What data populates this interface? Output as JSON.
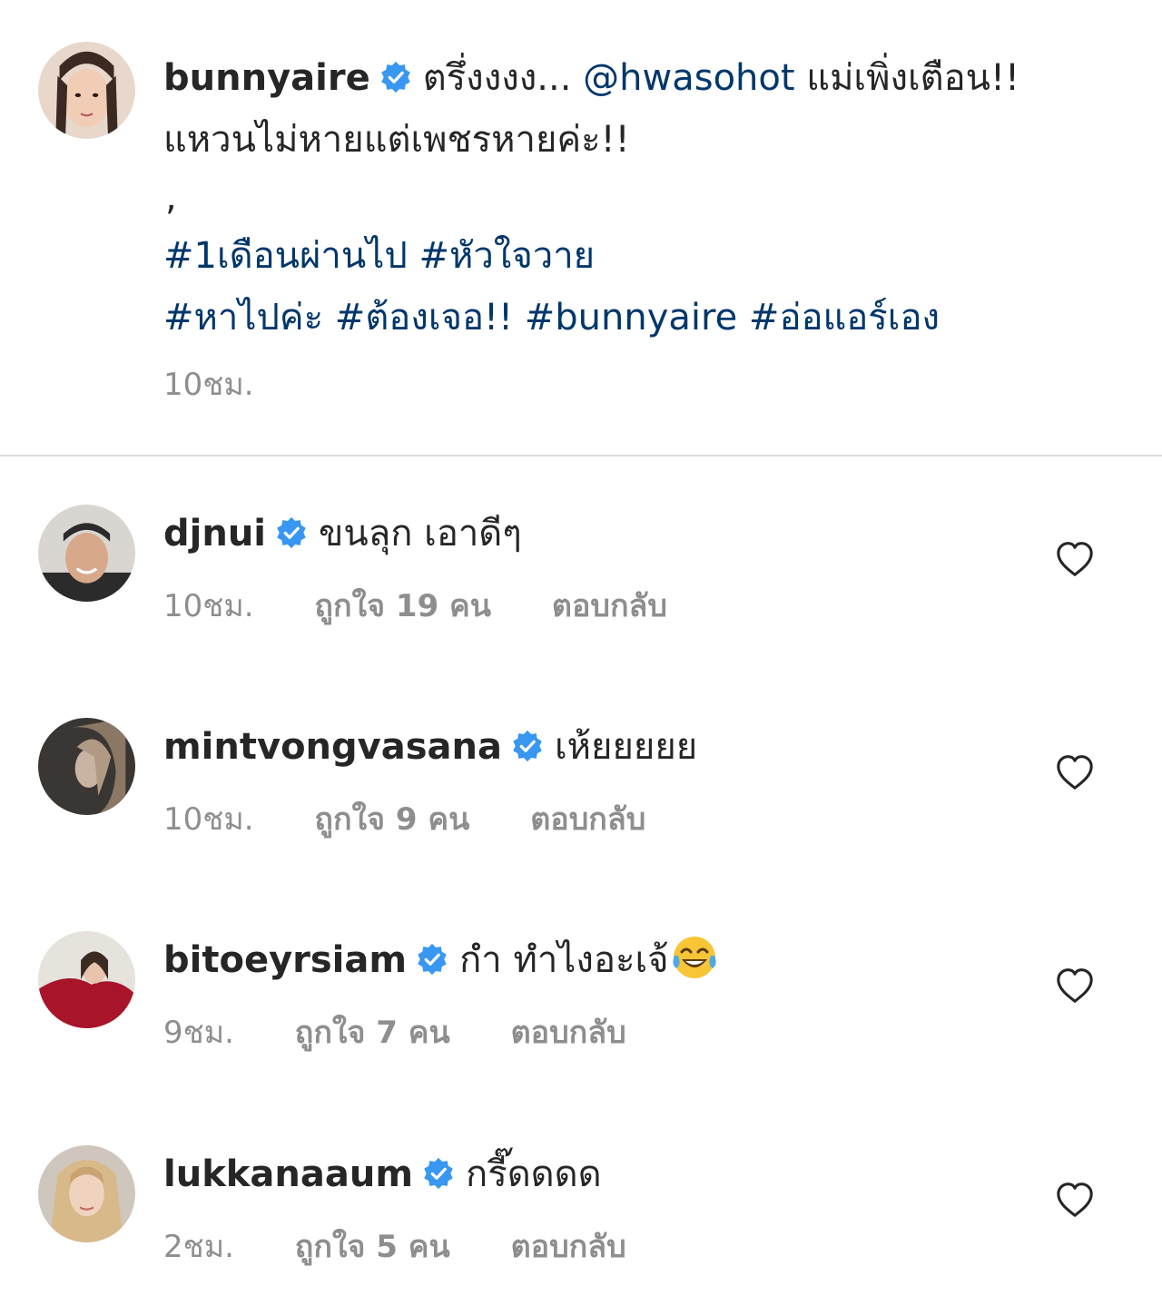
{
  "post": {
    "username": "bunnyaire",
    "text_line1": "ตรึ่งงงง...",
    "mention": "@hwasohot",
    "text_line1_end": "แม่เพิ่งเตือน!!",
    "text_line2": "แหวนไม่หายแต่เพชรหายค่ะ!!",
    "comma": ",",
    "hashtags_line1": "#1เดือนผ่านไป #หัวใจวาย",
    "hashtags_line2": "#หาไปค่ะ #ต้องเจอ!! #bunnyaire #อ่อแอร์เอง",
    "time": "10ชม."
  },
  "comments": [
    {
      "username": "djnui",
      "text": "ขนลุก เอาดีๆ",
      "time": "10ชม.",
      "likes": "ถูกใจ 19 คน",
      "reply": "ตอบกลับ"
    },
    {
      "username": "mintvongvasana",
      "text": "เห้ยยยยย",
      "time": "10ชม.",
      "likes": "ถูกใจ 9 คน",
      "reply": "ตอบกลับ"
    },
    {
      "username": "bitoeyrsiam",
      "text": "กำ ทำไงอะเจ้",
      "emoji": "tears-of-joy-emoji",
      "time": "9ชม.",
      "likes": "ถูกใจ 7 คน",
      "reply": "ตอบกลับ"
    },
    {
      "username": "lukkanaaum",
      "text": "กรี๊ดดดด",
      "time": "2ชม.",
      "likes": "ถูกใจ 5 คน",
      "reply": "ตอบกลับ"
    }
  ],
  "icons": {
    "verified": "verified-badge-icon",
    "like": "heart-outline-icon"
  },
  "colors": {
    "verified": "#3897f0",
    "link": "#00376b",
    "muted": "#8e8e8e",
    "text": "#262626",
    "divider": "#dbdbdb"
  }
}
